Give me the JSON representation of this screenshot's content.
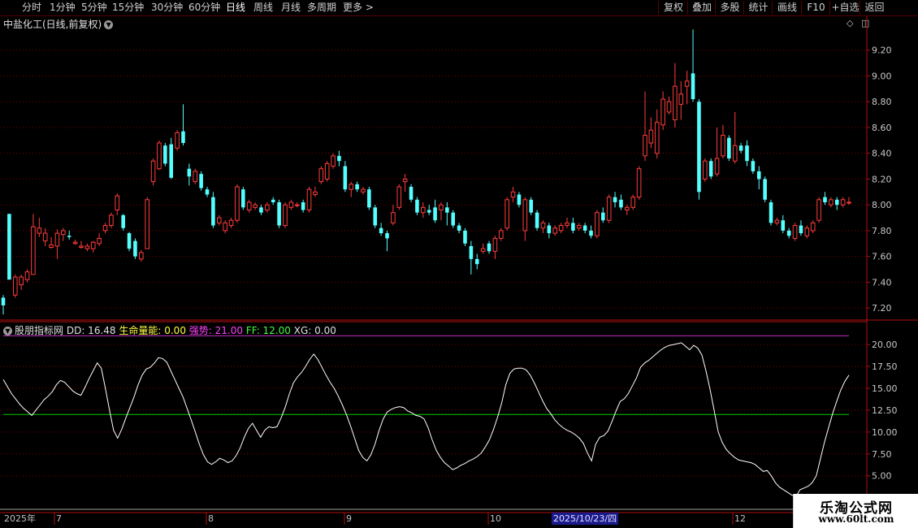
{
  "toolbar": {
    "periods": [
      "分时",
      "1分钟",
      "5分钟",
      "15分钟",
      "30分钟",
      "60分钟",
      "日线",
      "周线",
      "月线",
      "多周期",
      "更多 >"
    ],
    "active_period": "日线",
    "right_buttons": [
      "复权",
      "叠加",
      "多股",
      "统计",
      "画线",
      "F10",
      "+自选",
      "返回"
    ]
  },
  "stock": {
    "title": "中盐化工(日线,前复权)",
    "chevron": "v"
  },
  "indicator": {
    "name": "股朋指标网",
    "dd": "DD: 16.48",
    "life": "生命量能: 0.00",
    "strong": "强势: 21.00",
    "ff": "FF: 12.00",
    "xg": "XG: 0.00"
  },
  "x_axis": {
    "year_label": "2025年",
    "months": [
      "7",
      "8",
      "9",
      "10",
      "12"
    ],
    "date_tip": "2025/10/23/四"
  },
  "watermark": {
    "title": "乐淘公式网",
    "url": "www.60lt.com"
  },
  "colors": {
    "up": "#ff3c3c",
    "down": "#54ffff",
    "grid": "#7a0000",
    "axis": "#b01010",
    "dd_line": "#ffffff",
    "strong_line": "#c030c0",
    "ff_line": "#00cc00",
    "life_label": "#ffff40",
    "strong_label": "#ff40ff",
    "ff_label": "#40ff40"
  },
  "chart_data": [
    {
      "type": "candlestick",
      "title": "中盐化工(日线,前复权)",
      "ylim": [
        7.1,
        9.4
      ],
      "yticks": [
        "7.20",
        "7.40",
        "7.60",
        "7.80",
        "8.00",
        "8.20",
        "8.40",
        "8.60",
        "8.80",
        "9.00",
        "9.20"
      ],
      "candles": [
        [
          7.28,
          7.22,
          7.3,
          7.15
        ],
        [
          7.93,
          7.42,
          7.93,
          7.42
        ],
        [
          7.3,
          7.44,
          7.46,
          7.28
        ],
        [
          7.38,
          7.44,
          7.46,
          7.34
        ],
        [
          7.42,
          7.48,
          7.5,
          7.4
        ],
        [
          7.46,
          7.83,
          7.93,
          7.46
        ],
        [
          7.78,
          7.82,
          7.9,
          7.75
        ],
        [
          7.72,
          7.78,
          7.82,
          7.68
        ],
        [
          7.67,
          7.69,
          7.75,
          7.66
        ],
        [
          7.68,
          7.78,
          7.81,
          7.58
        ],
        [
          7.77,
          7.8,
          7.82,
          7.72
        ],
        [
          7.76,
          7.75,
          7.8,
          7.73
        ],
        [
          7.7,
          7.71,
          7.73,
          7.69
        ],
        [
          7.67,
          7.68,
          7.72,
          7.66
        ],
        [
          7.66,
          7.68,
          7.7,
          7.64
        ],
        [
          7.66,
          7.71,
          7.72,
          7.63
        ],
        [
          7.7,
          7.74,
          7.78,
          7.68
        ],
        [
          7.8,
          7.84,
          7.86,
          7.78
        ],
        [
          7.84,
          7.92,
          7.94,
          7.82
        ],
        [
          7.96,
          8.07,
          8.09,
          7.92
        ],
        [
          7.92,
          7.82,
          7.93,
          7.8
        ],
        [
          7.78,
          7.66,
          7.79,
          7.64
        ],
        [
          7.72,
          7.6,
          7.74,
          7.58
        ],
        [
          7.58,
          7.63,
          7.65,
          7.56
        ],
        [
          7.66,
          8.04,
          8.06,
          7.66
        ],
        [
          8.18,
          8.34,
          8.36,
          8.15
        ],
        [
          8.28,
          8.48,
          8.5,
          8.27
        ],
        [
          8.46,
          8.32,
          8.48,
          8.3
        ],
        [
          8.47,
          8.21,
          8.52,
          8.2
        ],
        [
          8.44,
          8.56,
          8.58,
          8.42
        ],
        [
          8.57,
          8.48,
          8.78,
          8.46
        ],
        [
          8.28,
          8.22,
          8.32,
          8.15
        ],
        [
          8.18,
          8.26,
          8.28,
          8.16
        ],
        [
          8.24,
          8.13,
          8.26,
          8.11
        ],
        [
          8.12,
          8.08,
          8.14,
          8.06
        ],
        [
          8.06,
          7.84,
          8.1,
          7.82
        ],
        [
          7.86,
          7.9,
          7.92,
          7.84
        ],
        [
          7.8,
          7.86,
          7.88,
          7.78
        ],
        [
          7.84,
          7.88,
          7.9,
          7.82
        ],
        [
          7.88,
          8.14,
          8.16,
          7.86
        ],
        [
          8.12,
          7.98,
          8.14,
          7.96
        ],
        [
          7.96,
          8.02,
          8.04,
          7.94
        ],
        [
          7.98,
          8.0,
          8.02,
          7.96
        ],
        [
          7.98,
          7.94,
          8.0,
          7.92
        ],
        [
          7.96,
          8.0,
          8.02,
          7.94
        ],
        [
          8.04,
          8.02,
          8.06,
          8.0
        ],
        [
          8.02,
          7.84,
          8.04,
          7.82
        ],
        [
          7.84,
          8.0,
          8.02,
          7.82
        ],
        [
          7.98,
          8.02,
          8.04,
          7.96
        ],
        [
          8.0,
          8.0,
          8.02,
          7.98
        ],
        [
          8.02,
          7.96,
          8.04,
          7.94
        ],
        [
          7.96,
          8.12,
          8.14,
          7.94
        ],
        [
          8.08,
          8.1,
          8.14,
          8.06
        ],
        [
          8.18,
          8.28,
          8.3,
          8.16
        ],
        [
          8.2,
          8.32,
          8.34,
          8.18
        ],
        [
          8.3,
          8.38,
          8.4,
          8.28
        ],
        [
          8.38,
          8.34,
          8.42,
          8.3
        ],
        [
          8.3,
          8.12,
          8.34,
          8.1
        ],
        [
          8.12,
          8.16,
          8.18,
          8.06
        ],
        [
          8.16,
          8.12,
          8.18,
          8.1
        ],
        [
          8.1,
          8.12,
          8.14,
          8.08
        ],
        [
          8.12,
          7.98,
          8.14,
          7.96
        ],
        [
          7.98,
          7.84,
          8.0,
          7.82
        ],
        [
          7.82,
          7.78,
          7.86,
          7.76
        ],
        [
          7.78,
          7.74,
          7.8,
          7.64
        ],
        [
          7.86,
          7.94,
          8.0,
          7.84
        ],
        [
          7.98,
          8.14,
          8.16,
          7.96
        ],
        [
          8.18,
          8.2,
          8.24,
          8.1
        ],
        [
          8.14,
          8.04,
          8.16,
          8.02
        ],
        [
          8.04,
          7.94,
          8.06,
          7.92
        ],
        [
          7.94,
          7.98,
          8.02,
          7.9
        ],
        [
          7.96,
          7.94,
          8.0,
          7.92
        ],
        [
          7.98,
          7.88,
          8.04,
          7.86
        ],
        [
          7.96,
          8.0,
          8.02,
          7.88
        ],
        [
          7.98,
          7.94,
          8.02,
          7.84
        ],
        [
          7.94,
          7.84,
          7.96,
          7.82
        ],
        [
          7.84,
          7.8,
          7.86,
          7.78
        ],
        [
          7.8,
          7.7,
          7.82,
          7.68
        ],
        [
          7.68,
          7.58,
          7.72,
          7.46
        ],
        [
          7.58,
          7.54,
          7.62,
          7.5
        ],
        [
          7.64,
          7.66,
          7.7,
          7.62
        ],
        [
          7.7,
          7.64,
          7.72,
          7.62
        ],
        [
          7.64,
          7.74,
          7.76,
          7.58
        ],
        [
          7.74,
          7.8,
          7.82,
          7.72
        ],
        [
          7.82,
          8.04,
          8.06,
          7.8
        ],
        [
          8.06,
          8.1,
          8.14,
          8.02
        ],
        [
          8.08,
          8.0,
          8.1,
          7.98
        ],
        [
          7.8,
          8.04,
          8.06,
          7.72
        ],
        [
          8.04,
          7.94,
          8.06,
          7.92
        ],
        [
          7.94,
          7.82,
          7.96,
          7.8
        ],
        [
          7.82,
          7.86,
          7.88,
          7.78
        ],
        [
          7.84,
          7.78,
          7.86,
          7.74
        ],
        [
          7.78,
          7.82,
          7.84,
          7.76
        ],
        [
          7.8,
          7.84,
          7.86,
          7.78
        ],
        [
          7.84,
          7.86,
          7.9,
          7.82
        ],
        [
          7.86,
          7.8,
          7.9,
          7.78
        ],
        [
          7.82,
          7.84,
          7.86,
          7.8
        ],
        [
          7.84,
          7.8,
          7.86,
          7.78
        ],
        [
          7.8,
          7.76,
          7.84,
          7.74
        ],
        [
          7.76,
          7.94,
          7.96,
          7.74
        ],
        [
          7.94,
          7.88,
          7.98,
          7.86
        ],
        [
          7.88,
          8.06,
          8.08,
          7.86
        ],
        [
          8.06,
          8.02,
          8.1,
          7.98
        ],
        [
          8.04,
          7.98,
          8.08,
          7.96
        ],
        [
          7.96,
          7.98,
          8.0,
          7.92
        ],
        [
          7.98,
          8.06,
          8.08,
          7.96
        ],
        [
          8.06,
          8.28,
          8.3,
          8.04
        ],
        [
          8.38,
          8.54,
          8.88,
          8.34
        ],
        [
          8.48,
          8.58,
          8.68,
          8.44
        ],
        [
          8.4,
          8.64,
          8.74,
          8.36
        ],
        [
          8.62,
          8.82,
          8.88,
          8.58
        ],
        [
          8.72,
          8.8,
          8.84,
          8.7
        ],
        [
          8.66,
          8.92,
          9.1,
          8.6
        ],
        [
          8.78,
          8.86,
          8.96,
          8.66
        ],
        [
          8.92,
          8.96,
          9.04,
          8.78
        ],
        [
          9.02,
          8.82,
          9.36,
          8.8
        ],
        [
          8.8,
          8.1,
          8.82,
          8.04
        ],
        [
          8.2,
          8.34,
          8.36,
          8.18
        ],
        [
          8.34,
          8.22,
          8.36,
          8.2
        ],
        [
          8.24,
          8.36,
          8.6,
          8.22
        ],
        [
          8.38,
          8.54,
          8.62,
          8.36
        ],
        [
          8.52,
          8.36,
          8.54,
          8.34
        ],
        [
          8.34,
          8.46,
          8.72,
          8.32
        ],
        [
          8.46,
          8.42,
          8.48,
          8.4
        ],
        [
          8.46,
          8.34,
          8.5,
          8.3
        ],
        [
          8.34,
          8.26,
          8.36,
          8.24
        ],
        [
          8.26,
          8.2,
          8.3,
          8.12
        ],
        [
          8.2,
          8.04,
          8.22,
          8.02
        ],
        [
          8.02,
          7.86,
          8.04,
          7.84
        ],
        [
          7.86,
          7.88,
          7.9,
          7.84
        ],
        [
          7.88,
          7.8,
          7.92,
          7.78
        ],
        [
          7.8,
          7.76,
          7.82,
          7.74
        ],
        [
          7.74,
          7.84,
          7.86,
          7.72
        ],
        [
          7.84,
          7.78,
          7.88,
          7.76
        ],
        [
          7.76,
          7.82,
          7.84,
          7.74
        ],
        [
          7.8,
          7.86,
          7.88,
          7.78
        ],
        [
          7.88,
          8.04,
          8.06,
          7.86
        ],
        [
          8.06,
          8.02,
          8.1,
          8.0
        ],
        [
          8.0,
          8.04,
          8.06,
          7.98
        ],
        [
          8.04,
          8.0,
          8.06,
          7.96
        ],
        [
          8.0,
          8.04,
          8.06,
          7.98
        ],
        [
          8.02,
          8.02,
          8.06,
          8.0
        ]
      ]
    },
    {
      "type": "line",
      "title": "股朋指标网",
      "ylim": [
        2.0,
        21.5
      ],
      "yticks": [
        "5.00",
        "7.50",
        "10.00",
        "12.50",
        "15.00",
        "17.50",
        "20.00"
      ],
      "ff_level": 12.0,
      "strong_level": 21.0,
      "dd": [
        16,
        15.2,
        14.4,
        13.8,
        13.2,
        12.7,
        12.3,
        11.9,
        12.5,
        13.1,
        13.7,
        14.1,
        14.6,
        15.4,
        15.9,
        15.7,
        15.2,
        14.7,
        14.4,
        14.2,
        15.1,
        16.1,
        17.0,
        17.9,
        17.3,
        15.0,
        12.5,
        10.2,
        9.3,
        10.3,
        11.6,
        12.8,
        14.0,
        15.4,
        16.5,
        17.2,
        17.4,
        17.9,
        18.5,
        18.4,
        18.0,
        17.0,
        16.0,
        15.0,
        14.0,
        12.7,
        11.4,
        10.0,
        8.6,
        7.4,
        6.6,
        6.3,
        6.6,
        7.0,
        6.8,
        6.5,
        6.7,
        7.3,
        8.2,
        9.4,
        10.4,
        11.0,
        10.2,
        9.4,
        10.2,
        10.6,
        10.5,
        10.6,
        11.6,
        12.8,
        14.3,
        15.6,
        16.3,
        16.8,
        17.5,
        18.3,
        18.9,
        18.3,
        17.4,
        16.5,
        15.7,
        15.0,
        14.1,
        13.1,
        12.0,
        10.7,
        9.3,
        7.9,
        7.1,
        6.7,
        7.4,
        8.6,
        10.2,
        11.5,
        12.3,
        12.6,
        12.8,
        12.9,
        12.8,
        12.4,
        12.2,
        11.9,
        11.8,
        11.5,
        10.5,
        9.1,
        7.9,
        7.1,
        6.5,
        6.1,
        5.7,
        5.9,
        6.2,
        6.4,
        6.7,
        6.9,
        7.2,
        7.6,
        8.3,
        9.1,
        10.3,
        11.7,
        13.3,
        15.4,
        16.7,
        17.2,
        17.3,
        17.3,
        17.1,
        16.5,
        15.6,
        14.6,
        13.6,
        12.7,
        12.1,
        11.4,
        10.9,
        10.5,
        10.2,
        10.0,
        9.7,
        9.3,
        8.7,
        7.6,
        6.7,
        8.6,
        9.4,
        9.6,
        10.1,
        11.2,
        12.4,
        13.5,
        13.8,
        14.4,
        15.3,
        16.2,
        17.4,
        17.9,
        18.2,
        18.6,
        19.0,
        19.4,
        19.7,
        19.9,
        20.0,
        20.1,
        20.2,
        19.8,
        19.4,
        19.9,
        19.6,
        18.8,
        17.0,
        14.9,
        12.5,
        10.0,
        8.8,
        8.0,
        7.5,
        7.1,
        6.8,
        6.7,
        6.6,
        6.5,
        6.3,
        5.9,
        5.5,
        5.6,
        5.0,
        4.2,
        3.7,
        3.4,
        3.1,
        2.8,
        2.6,
        3.4,
        3.6,
        3.8,
        4.2,
        5.0,
        6.9,
        8.8,
        10.5,
        12.1,
        13.5,
        14.8,
        15.8,
        16.5
      ]
    }
  ]
}
